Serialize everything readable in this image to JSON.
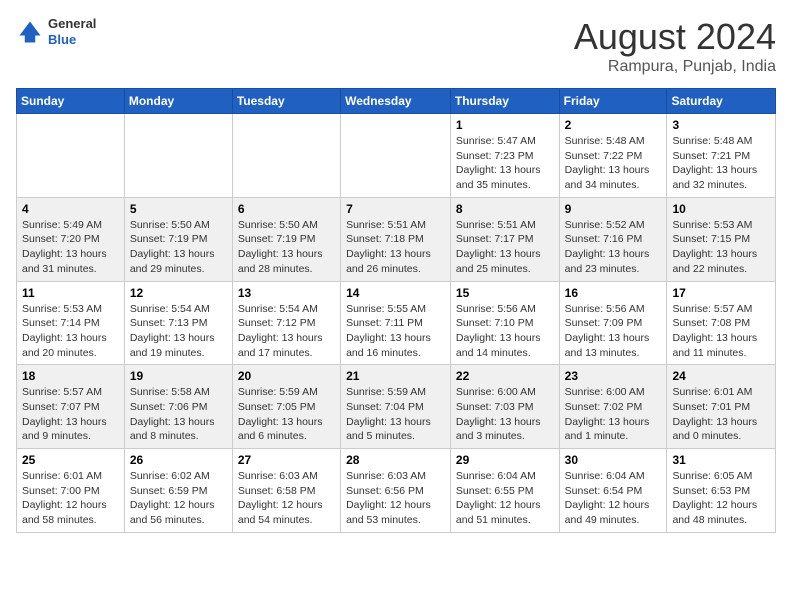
{
  "header": {
    "logo": {
      "line1": "General",
      "line2": "Blue"
    },
    "title": "August 2024",
    "location": "Rampura, Punjab, India"
  },
  "weekdays": [
    "Sunday",
    "Monday",
    "Tuesday",
    "Wednesday",
    "Thursday",
    "Friday",
    "Saturday"
  ],
  "weeks": [
    [
      {
        "day": "",
        "info": ""
      },
      {
        "day": "",
        "info": ""
      },
      {
        "day": "",
        "info": ""
      },
      {
        "day": "",
        "info": ""
      },
      {
        "day": "1",
        "info": "Sunrise: 5:47 AM\nSunset: 7:23 PM\nDaylight: 13 hours\nand 35 minutes."
      },
      {
        "day": "2",
        "info": "Sunrise: 5:48 AM\nSunset: 7:22 PM\nDaylight: 13 hours\nand 34 minutes."
      },
      {
        "day": "3",
        "info": "Sunrise: 5:48 AM\nSunset: 7:21 PM\nDaylight: 13 hours\nand 32 minutes."
      }
    ],
    [
      {
        "day": "4",
        "info": "Sunrise: 5:49 AM\nSunset: 7:20 PM\nDaylight: 13 hours\nand 31 minutes."
      },
      {
        "day": "5",
        "info": "Sunrise: 5:50 AM\nSunset: 7:19 PM\nDaylight: 13 hours\nand 29 minutes."
      },
      {
        "day": "6",
        "info": "Sunrise: 5:50 AM\nSunset: 7:19 PM\nDaylight: 13 hours\nand 28 minutes."
      },
      {
        "day": "7",
        "info": "Sunrise: 5:51 AM\nSunset: 7:18 PM\nDaylight: 13 hours\nand 26 minutes."
      },
      {
        "day": "8",
        "info": "Sunrise: 5:51 AM\nSunset: 7:17 PM\nDaylight: 13 hours\nand 25 minutes."
      },
      {
        "day": "9",
        "info": "Sunrise: 5:52 AM\nSunset: 7:16 PM\nDaylight: 13 hours\nand 23 minutes."
      },
      {
        "day": "10",
        "info": "Sunrise: 5:53 AM\nSunset: 7:15 PM\nDaylight: 13 hours\nand 22 minutes."
      }
    ],
    [
      {
        "day": "11",
        "info": "Sunrise: 5:53 AM\nSunset: 7:14 PM\nDaylight: 13 hours\nand 20 minutes."
      },
      {
        "day": "12",
        "info": "Sunrise: 5:54 AM\nSunset: 7:13 PM\nDaylight: 13 hours\nand 19 minutes."
      },
      {
        "day": "13",
        "info": "Sunrise: 5:54 AM\nSunset: 7:12 PM\nDaylight: 13 hours\nand 17 minutes."
      },
      {
        "day": "14",
        "info": "Sunrise: 5:55 AM\nSunset: 7:11 PM\nDaylight: 13 hours\nand 16 minutes."
      },
      {
        "day": "15",
        "info": "Sunrise: 5:56 AM\nSunset: 7:10 PM\nDaylight: 13 hours\nand 14 minutes."
      },
      {
        "day": "16",
        "info": "Sunrise: 5:56 AM\nSunset: 7:09 PM\nDaylight: 13 hours\nand 13 minutes."
      },
      {
        "day": "17",
        "info": "Sunrise: 5:57 AM\nSunset: 7:08 PM\nDaylight: 13 hours\nand 11 minutes."
      }
    ],
    [
      {
        "day": "18",
        "info": "Sunrise: 5:57 AM\nSunset: 7:07 PM\nDaylight: 13 hours\nand 9 minutes."
      },
      {
        "day": "19",
        "info": "Sunrise: 5:58 AM\nSunset: 7:06 PM\nDaylight: 13 hours\nand 8 minutes."
      },
      {
        "day": "20",
        "info": "Sunrise: 5:59 AM\nSunset: 7:05 PM\nDaylight: 13 hours\nand 6 minutes."
      },
      {
        "day": "21",
        "info": "Sunrise: 5:59 AM\nSunset: 7:04 PM\nDaylight: 13 hours\nand 5 minutes."
      },
      {
        "day": "22",
        "info": "Sunrise: 6:00 AM\nSunset: 7:03 PM\nDaylight: 13 hours\nand 3 minutes."
      },
      {
        "day": "23",
        "info": "Sunrise: 6:00 AM\nSunset: 7:02 PM\nDaylight: 13 hours\nand 1 minute."
      },
      {
        "day": "24",
        "info": "Sunrise: 6:01 AM\nSunset: 7:01 PM\nDaylight: 13 hours\nand 0 minutes."
      }
    ],
    [
      {
        "day": "25",
        "info": "Sunrise: 6:01 AM\nSunset: 7:00 PM\nDaylight: 12 hours\nand 58 minutes."
      },
      {
        "day": "26",
        "info": "Sunrise: 6:02 AM\nSunset: 6:59 PM\nDaylight: 12 hours\nand 56 minutes."
      },
      {
        "day": "27",
        "info": "Sunrise: 6:03 AM\nSunset: 6:58 PM\nDaylight: 12 hours\nand 54 minutes."
      },
      {
        "day": "28",
        "info": "Sunrise: 6:03 AM\nSunset: 6:56 PM\nDaylight: 12 hours\nand 53 minutes."
      },
      {
        "day": "29",
        "info": "Sunrise: 6:04 AM\nSunset: 6:55 PM\nDaylight: 12 hours\nand 51 minutes."
      },
      {
        "day": "30",
        "info": "Sunrise: 6:04 AM\nSunset: 6:54 PM\nDaylight: 12 hours\nand 49 minutes."
      },
      {
        "day": "31",
        "info": "Sunrise: 6:05 AM\nSunset: 6:53 PM\nDaylight: 12 hours\nand 48 minutes."
      }
    ]
  ]
}
